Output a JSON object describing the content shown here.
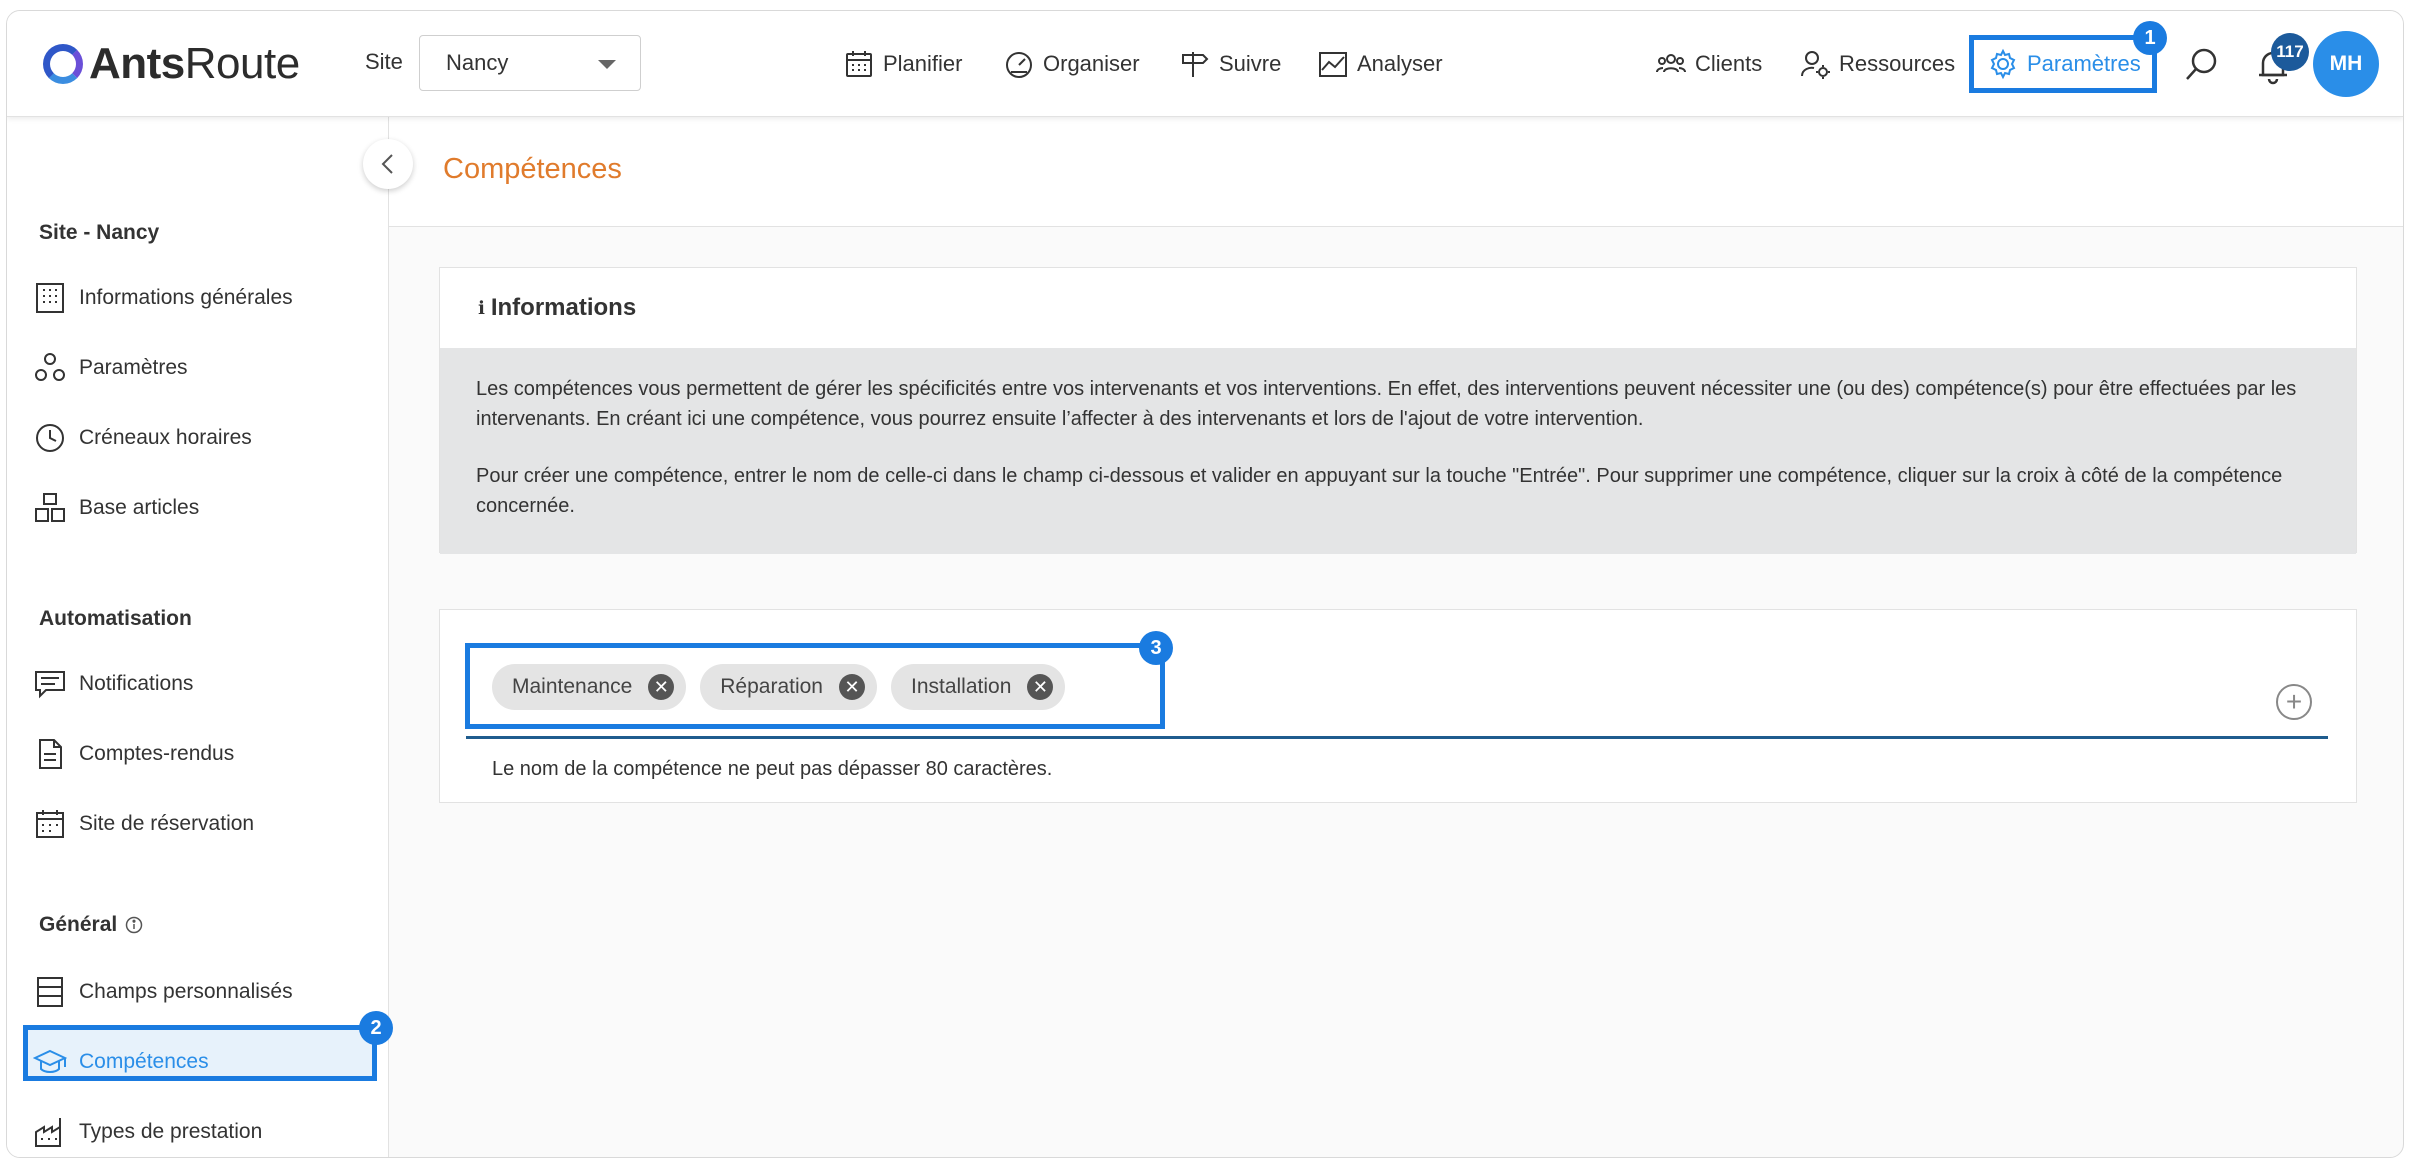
{
  "header": {
    "logo_bold": "Ants",
    "logo_regular": "Route",
    "site_label": "Site",
    "site_value": "Nancy",
    "nav": {
      "planifier": "Planifier",
      "organiser": "Organiser",
      "suivre": "Suivre",
      "analyser": "Analyser",
      "clients": "Clients",
      "ressources": "Ressources",
      "parametres": "Paramètres"
    },
    "notification_count": "117",
    "avatar_initials": "MH"
  },
  "annotations": [
    "1",
    "2",
    "3"
  ],
  "sidebar": {
    "section_site": "Site - Nancy",
    "section_automation": "Automatisation",
    "section_general": "Général",
    "items": {
      "informations": "Informations générales",
      "parametres": "Paramètres",
      "creneaux": "Créneaux horaires",
      "articles": "Base articles",
      "notifications": "Notifications",
      "comptes_rendus": "Comptes-rendus",
      "reservation": "Site de réservation",
      "champs": "Champs personnalisés",
      "competences": "Compétences",
      "prestations": "Types de prestation"
    }
  },
  "main": {
    "page_title": "Compétences",
    "info_title": "Informations",
    "info_paragraph_1": "Les compétences vous permettent de gérer les spécificités entre vos intervenants et vos interventions. En effet, des interventions peuvent nécessiter une (ou des) compétence(s) pour être effectuées par les intervenants. En créant ici une compétence, vous pourrez ensuite l’affecter à des intervenants et lors de l'ajout de votre intervention.",
    "info_paragraph_2": "Pour créer une compétence, entrer le nom de celle-ci dans le champ ci-dessous et valider en appuyant sur la touche \"Entrée\". Pour supprimer une compétence, cliquer sur la croix à côté de la compétence concernée.",
    "tags": [
      "Maintenance",
      "Réparation",
      "Installation"
    ],
    "hint": "Le nom de la compétence ne peut pas dépasser 80 caractères."
  }
}
